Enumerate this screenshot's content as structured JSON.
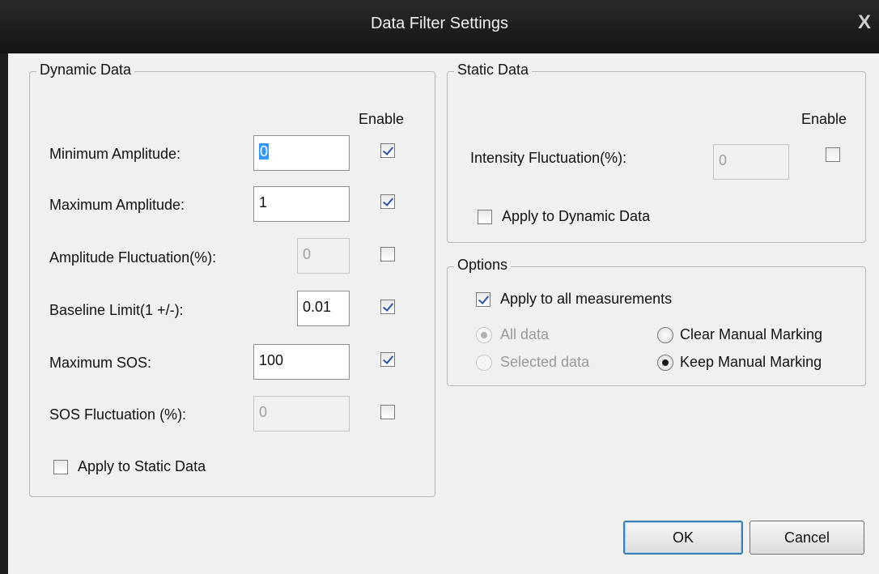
{
  "window": {
    "title": "Data Filter Settings",
    "close_glyph": "X"
  },
  "dynamic": {
    "legend": "Dynamic Data",
    "enable_header": "Enable",
    "rows": [
      {
        "label": "Minimum Amplitude:",
        "value": "0",
        "enabled": true
      },
      {
        "label": "Maximum Amplitude:",
        "value": "1",
        "enabled": true
      },
      {
        "label": "Amplitude Fluctuation(%):",
        "value": "0",
        "enabled": false
      },
      {
        "label": "Baseline Limit(1 +/-):",
        "value": "0.01",
        "enabled": true
      },
      {
        "label": "Maximum SOS:",
        "value": "100",
        "enabled": true
      },
      {
        "label": "SOS Fluctuation (%):",
        "value": "0",
        "enabled": false
      }
    ],
    "apply_label": "Apply to Static Data",
    "apply_checked": false
  },
  "static": {
    "legend": "Static Data",
    "enable_header": "Enable",
    "intensity_label": "Intensity Fluctuation(%):",
    "intensity_value": "0",
    "intensity_enabled": false,
    "apply_label": "Apply to Dynamic Data",
    "apply_checked": false
  },
  "options": {
    "legend": "Options",
    "apply_all_label": "Apply to all measurements",
    "apply_all_checked": true,
    "all_data": "All data",
    "selected_data": "Selected data",
    "clear_marking": "Clear Manual Marking",
    "keep_marking": "Keep Manual Marking",
    "data_scope": "All data",
    "marking_choice": "Keep Manual Marking"
  },
  "buttons": {
    "ok": "OK",
    "cancel": "Cancel"
  }
}
